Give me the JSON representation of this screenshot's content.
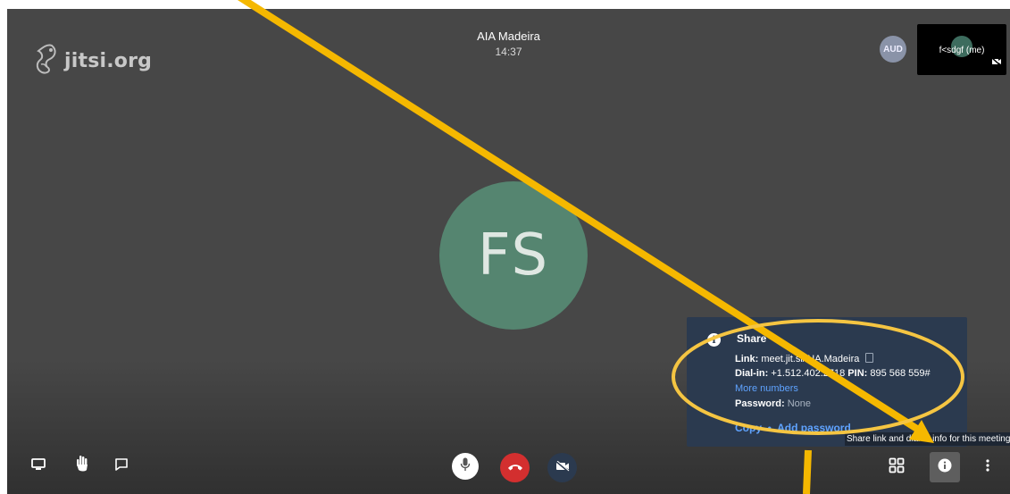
{
  "brand": {
    "logo_text": "jitsi.org"
  },
  "meeting": {
    "title": "AIA Madeira",
    "time": "14:37"
  },
  "participants": {
    "audio_only_initials": "AUD",
    "self_tile_name": "f<sdgf (me)"
  },
  "main_avatar": {
    "initials": "FS",
    "color": "#558570"
  },
  "info_panel": {
    "title": "Share",
    "link_label": "Link:",
    "link_value": "meet.jit.si/AIA.Madeira",
    "dialin_label": "Dial-in:",
    "dialin_value": "+1.512.402.2718",
    "pin_label": "PIN:",
    "pin_value": "895 568 559#",
    "more_numbers": "More numbers",
    "password_label": "Password:",
    "password_value": "None",
    "copy_action": "Copy",
    "separator": "•",
    "add_password_action": "Add password"
  },
  "tooltip": {
    "text": "Share link and dial-in info for this meeting"
  },
  "toolbar": {
    "left_icons": [
      "screen-share-icon",
      "raise-hand-icon",
      "chat-icon"
    ],
    "center_icons": [
      "microphone-icon",
      "hangup-icon",
      "camera-off-icon"
    ],
    "right_icons": [
      "tile-view-icon",
      "info-icon",
      "more-options-icon"
    ],
    "hangup_color": "#d32f2f"
  },
  "annotation": {
    "color": "#f5b800"
  }
}
